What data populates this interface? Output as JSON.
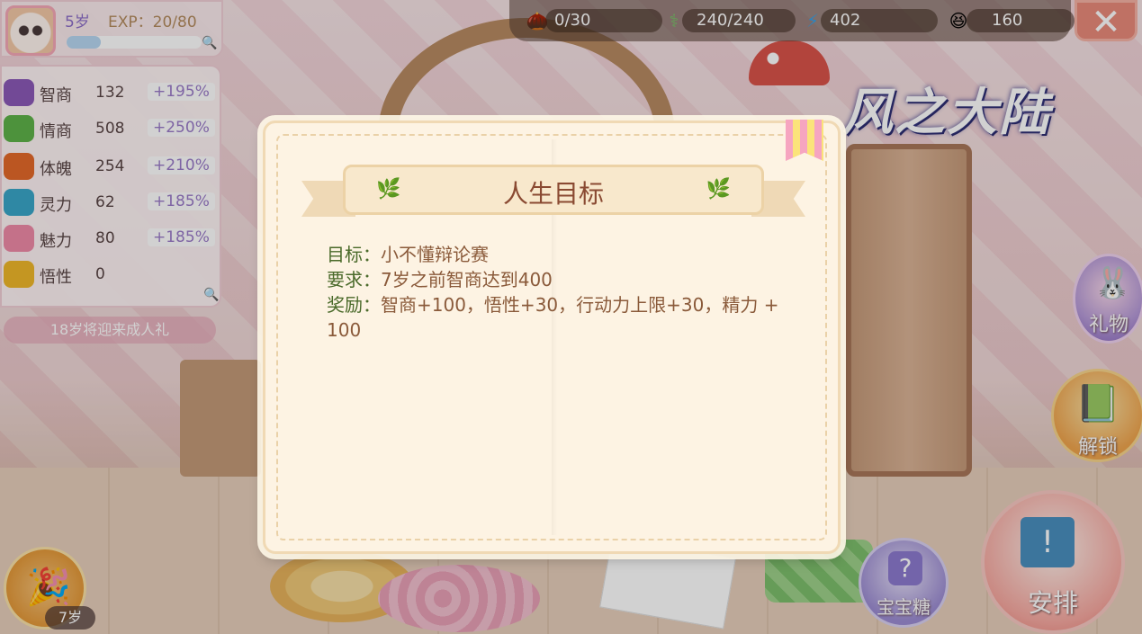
{
  "player": {
    "age": "5岁",
    "exp": "EXP：20/80",
    "exp_progress": 0.25
  },
  "stats": [
    {
      "name": "智商",
      "value": "132",
      "bonus": "+195%",
      "color": "#8b5ab8"
    },
    {
      "name": "情商",
      "value": "508",
      "bonus": "+250%",
      "color": "#5fb34a"
    },
    {
      "name": "体魄",
      "value": "254",
      "bonus": "+210%",
      "color": "#e56a2a"
    },
    {
      "name": "灵力",
      "value": "62",
      "bonus": "+185%",
      "color": "#3aa6c9"
    },
    {
      "name": "魅力",
      "value": "80",
      "bonus": "+185%",
      "color": "#f08aa8"
    },
    {
      "name": "悟性",
      "value": "0",
      "bonus": "",
      "color": "#f0b82a"
    }
  ],
  "coming_of_age": "18岁将迎来成人礼",
  "resources": [
    {
      "icon": "acorn-icon",
      "glyph": "🌰",
      "value": "0/30"
    },
    {
      "icon": "stamina-icon",
      "glyph": "⚕",
      "value": "240/240"
    },
    {
      "icon": "energy-icon",
      "glyph": "⚡",
      "value": "402"
    },
    {
      "icon": "smile-icon",
      "glyph": "😆",
      "value": "160"
    }
  ],
  "logo_text": "风之大陆",
  "side_buttons": {
    "gift": "礼物",
    "unlock": "解锁",
    "arrange": "安排",
    "candy": "宝宝糖",
    "age": "7岁"
  },
  "modal": {
    "title": "人生目标",
    "goal_label": "目标：",
    "goal_value": "小不懂辩论赛",
    "req_label": "要求：",
    "req_value": "7岁之前智商达到400",
    "reward_label": "奖励：",
    "reward_value": "智商+100，悟性+30，行动力上限+30，精力 + 100"
  },
  "colors": {
    "accent": "#8b6cc7",
    "title": "#8a4a32",
    "modal_bg": "#fdf3e3"
  }
}
